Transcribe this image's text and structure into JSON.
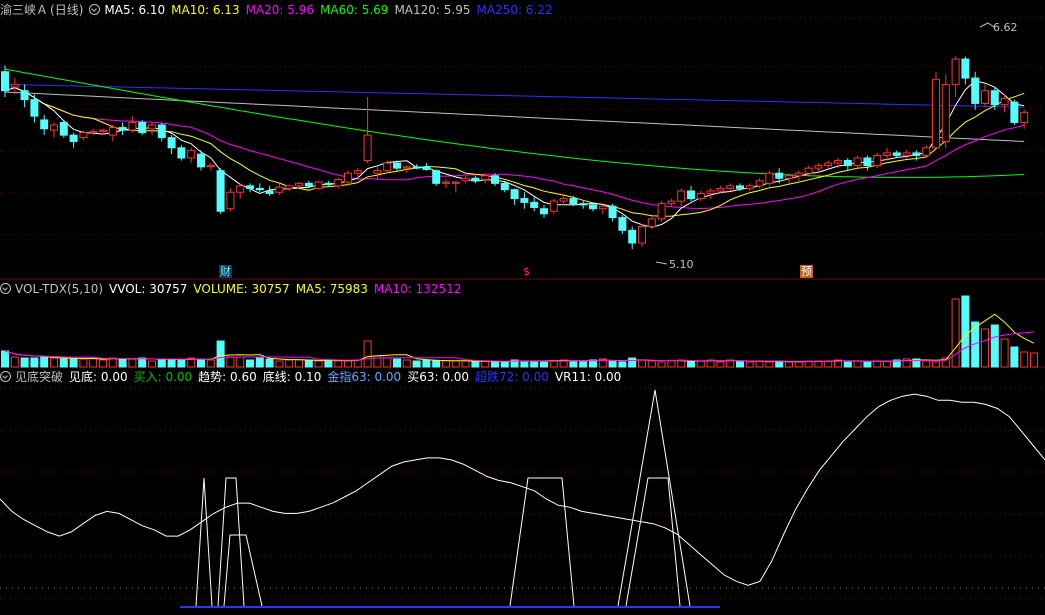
{
  "colors": {
    "background": "#000000",
    "up": "#ff3232",
    "down": "#54fcfc",
    "grid": "#800000",
    "ma5": "#ffffff",
    "ma10": "#ffff00",
    "ma20": "#ff00ff",
    "ma60": "#00ff00",
    "ma120": "#c0c0c0",
    "ma250": "#3030ff",
    "buy": "#00c000",
    "gold": "#5aaaff",
    "vr": "#ffffff"
  },
  "price_panel": {
    "title": "渝三峡Ａ",
    "period": "(日线)",
    "indicators": [
      {
        "label": "MA5: 6.10",
        "color": "#ffffff"
      },
      {
        "label": "MA10: 6.13",
        "color": "#ffff00"
      },
      {
        "label": "MA20: 5.96",
        "color": "#ff00ff"
      },
      {
        "label": "MA60: 5.69",
        "color": "#00ff00"
      },
      {
        "label": "MA120: 5.95",
        "color": "#c0c0c0"
      },
      {
        "label": "MA250: 6.22",
        "color": "#3030ff"
      }
    ],
    "high_label": "6.62",
    "low_label": "5.10",
    "markers": [
      {
        "text": "财",
        "color": "#54fcfc",
        "bg": "#203060"
      },
      {
        "text": "$",
        "color": "#ff3030",
        "bg": ""
      },
      {
        "text": "预",
        "color": "#ffffff",
        "bg": "#c06020"
      }
    ]
  },
  "volume_panel": {
    "indicators": [
      {
        "label": "VOL-TDX(5,10)",
        "color": "#c0c0c0"
      },
      {
        "label": "VVOL: 30757",
        "color": "#ffffff"
      },
      {
        "label": "VOLUME: 30757",
        "color": "#ffff00"
      },
      {
        "label": "MA5: 75983",
        "color": "#ffff00"
      },
      {
        "label": "MA10: 132512",
        "color": "#ff00ff"
      }
    ]
  },
  "indicator_panel": {
    "indicators": [
      {
        "label": "见底突破",
        "color": "#c0c0c0"
      },
      {
        "label": "见底: 0.00",
        "color": "#ffffff"
      },
      {
        "label": "买入: 0.00",
        "color": "#00c000"
      },
      {
        "label": "趋势: 0.60",
        "color": "#ffffff"
      },
      {
        "label": "底线: 0.10",
        "color": "#ffffff"
      },
      {
        "label": "金指63: 0.00",
        "color": "#5aaaff"
      },
      {
        "label": "买63: 0.00",
        "color": "#ffffff"
      },
      {
        "label": "超跌72: 0.00",
        "color": "#3030ff"
      },
      {
        "label": "VR11: 0.00",
        "color": "#ffffff"
      }
    ]
  },
  "chart_data": {
    "type": "candlestick",
    "price_range": [
      5.0,
      6.75
    ],
    "candles": [
      [
        6.5,
        6.55,
        6.3,
        6.35
      ],
      [
        6.38,
        6.45,
        6.32,
        6.4
      ],
      [
        6.35,
        6.4,
        6.22,
        6.28
      ],
      [
        6.28,
        6.32,
        6.1,
        6.15
      ],
      [
        6.12,
        6.16,
        6.0,
        6.05
      ],
      [
        6.04,
        6.1,
        5.98,
        6.08
      ],
      [
        6.1,
        6.12,
        5.98,
        6.0
      ],
      [
        6.0,
        6.02,
        5.9,
        5.95
      ],
      [
        5.98,
        6.04,
        5.96,
        6.02
      ],
      [
        6.02,
        6.05,
        6.0,
        6.03
      ],
      [
        6.03,
        6.05,
        6.0,
        6.04
      ],
      [
        6.0,
        6.08,
        5.95,
        6.06
      ],
      [
        6.06,
        6.1,
        6.0,
        6.04
      ],
      [
        6.04,
        6.15,
        6.02,
        6.1
      ],
      [
        6.1,
        6.12,
        6.0,
        6.02
      ],
      [
        6.05,
        6.1,
        6.0,
        6.08
      ],
      [
        6.08,
        6.1,
        5.95,
        5.98
      ],
      [
        5.98,
        6.0,
        5.85,
        5.9
      ],
      [
        5.9,
        5.92,
        5.8,
        5.82
      ],
      [
        5.82,
        5.9,
        5.78,
        5.88
      ],
      [
        5.85,
        5.88,
        5.72,
        5.75
      ],
      [
        5.75,
        5.78,
        5.72,
        5.76
      ],
      [
        5.72,
        5.74,
        5.38,
        5.4
      ],
      [
        5.42,
        5.58,
        5.4,
        5.55
      ],
      [
        5.55,
        5.62,
        5.5,
        5.6
      ],
      [
        5.6,
        5.62,
        5.55,
        5.58
      ],
      [
        5.58,
        5.62,
        5.55,
        5.57
      ],
      [
        5.56,
        5.6,
        5.52,
        5.54
      ],
      [
        5.55,
        5.62,
        5.53,
        5.59
      ],
      [
        5.58,
        5.61,
        5.56,
        5.6
      ],
      [
        5.6,
        5.63,
        5.58,
        5.62
      ],
      [
        5.62,
        5.64,
        5.58,
        5.6
      ],
      [
        5.58,
        5.64,
        5.57,
        5.63
      ],
      [
        5.62,
        5.64,
        5.6,
        5.61
      ],
      [
        5.6,
        5.66,
        5.58,
        5.65
      ],
      [
        5.63,
        5.72,
        5.6,
        5.7
      ],
      [
        5.7,
        5.74,
        5.66,
        5.72
      ],
      [
        5.8,
        6.3,
        5.78,
        6.0
      ],
      [
        5.7,
        5.75,
        5.65,
        5.72
      ],
      [
        5.72,
        5.8,
        5.7,
        5.78
      ],
      [
        5.78,
        5.8,
        5.72,
        5.74
      ],
      [
        5.74,
        5.76,
        5.7,
        5.75
      ],
      [
        5.75,
        5.77,
        5.73,
        5.74
      ],
      [
        5.75,
        5.78,
        5.72,
        5.73
      ],
      [
        5.72,
        5.73,
        5.6,
        5.62
      ],
      [
        5.62,
        5.65,
        5.58,
        5.63
      ],
      [
        5.62,
        5.64,
        5.55,
        5.63
      ],
      [
        5.64,
        5.68,
        5.62,
        5.66
      ],
      [
        5.66,
        5.68,
        5.62,
        5.64
      ],
      [
        5.65,
        5.7,
        5.62,
        5.68
      ],
      [
        5.68,
        5.7,
        5.6,
        5.62
      ],
      [
        5.62,
        5.63,
        5.55,
        5.57
      ],
      [
        5.57,
        5.58,
        5.45,
        5.5
      ],
      [
        5.5,
        5.55,
        5.42,
        5.47
      ],
      [
        5.47,
        5.52,
        5.4,
        5.43
      ],
      [
        5.42,
        5.45,
        5.35,
        5.38
      ],
      [
        5.4,
        5.5,
        5.38,
        5.48
      ],
      [
        5.48,
        5.52,
        5.45,
        5.5
      ],
      [
        5.5,
        5.52,
        5.44,
        5.46
      ],
      [
        5.46,
        5.48,
        5.42,
        5.45
      ],
      [
        5.45,
        5.47,
        5.4,
        5.42
      ],
      [
        5.42,
        5.45,
        5.38,
        5.44
      ],
      [
        5.44,
        5.46,
        5.32,
        5.35
      ],
      [
        5.35,
        5.37,
        5.22,
        5.25
      ],
      [
        5.25,
        5.28,
        5.1,
        5.15
      ],
      [
        5.15,
        5.3,
        5.12,
        5.28
      ],
      [
        5.28,
        5.36,
        5.26,
        5.34
      ],
      [
        5.34,
        5.48,
        5.32,
        5.46
      ],
      [
        5.46,
        5.5,
        5.44,
        5.48
      ],
      [
        5.48,
        5.58,
        5.44,
        5.56
      ],
      [
        5.56,
        5.6,
        5.48,
        5.5
      ],
      [
        5.5,
        5.56,
        5.48,
        5.54
      ],
      [
        5.54,
        5.58,
        5.5,
        5.56
      ],
      [
        5.56,
        5.6,
        5.54,
        5.58
      ],
      [
        5.58,
        5.62,
        5.56,
        5.6
      ],
      [
        5.6,
        5.62,
        5.56,
        5.58
      ],
      [
        5.58,
        5.62,
        5.56,
        5.6
      ],
      [
        5.6,
        5.66,
        5.58,
        5.64
      ],
      [
        5.62,
        5.72,
        5.6,
        5.7
      ],
      [
        5.7,
        5.74,
        5.62,
        5.66
      ],
      [
        5.66,
        5.7,
        5.62,
        5.68
      ],
      [
        5.68,
        5.72,
        5.64,
        5.7
      ],
      [
        5.7,
        5.76,
        5.68,
        5.74
      ],
      [
        5.74,
        5.78,
        5.7,
        5.76
      ],
      [
        5.76,
        5.8,
        5.74,
        5.78
      ],
      [
        5.78,
        5.82,
        5.74,
        5.8
      ],
      [
        5.8,
        5.82,
        5.72,
        5.76
      ],
      [
        5.76,
        5.84,
        5.74,
        5.82
      ],
      [
        5.82,
        5.84,
        5.72,
        5.76
      ],
      [
        5.76,
        5.86,
        5.74,
        5.84
      ],
      [
        5.84,
        5.9,
        5.8,
        5.86
      ],
      [
        5.86,
        5.88,
        5.82,
        5.84
      ],
      [
        5.84,
        5.88,
        5.82,
        5.86
      ],
      [
        5.86,
        5.88,
        5.8,
        5.84
      ],
      [
        5.84,
        5.92,
        5.82,
        5.9
      ],
      [
        5.9,
        6.5,
        5.9,
        6.44
      ],
      [
        5.95,
        6.48,
        5.9,
        6.4
      ],
      [
        6.4,
        6.62,
        6.3,
        6.6
      ],
      [
        6.6,
        6.62,
        6.4,
        6.45
      ],
      [
        6.45,
        6.5,
        6.2,
        6.25
      ],
      [
        6.25,
        6.4,
        6.22,
        6.35
      ],
      [
        6.35,
        6.38,
        6.2,
        6.24
      ],
      [
        6.24,
        6.32,
        6.18,
        6.29
      ],
      [
        6.26,
        6.28,
        6.08,
        6.1
      ],
      [
        6.1,
        6.2,
        6.05,
        6.18
      ]
    ],
    "volume": [
      16,
      10,
      9,
      9,
      10,
      9,
      8,
      8,
      8,
      9,
      7,
      9,
      8,
      8,
      9,
      6,
      8,
      8,
      7,
      9,
      8,
      7,
      26,
      10,
      10,
      7,
      9,
      8,
      6,
      7,
      7,
      7,
      6,
      7,
      6,
      6,
      7,
      26,
      11,
      9,
      8,
      7,
      6,
      7,
      6,
      6,
      6,
      6,
      5,
      6,
      5,
      5,
      7,
      6,
      6,
      6,
      6,
      7,
      6,
      6,
      7,
      8,
      6,
      5,
      9,
      7,
      6,
      5,
      6,
      7,
      6,
      6,
      7,
      5,
      7,
      6,
      5,
      6,
      5,
      6,
      5,
      5,
      6,
      6,
      6,
      7,
      5,
      6,
      5,
      6,
      6,
      7,
      8,
      8,
      6,
      5,
      9,
      68,
      71,
      45,
      38,
      42,
      28,
      20,
      15,
      14
    ],
    "indicator_trend": [
      0.52,
      0.46,
      0.42,
      0.39,
      0.36,
      0.34,
      0.36,
      0.4,
      0.44,
      0.46,
      0.45,
      0.42,
      0.39,
      0.37,
      0.34,
      0.34,
      0.37,
      0.41,
      0.45,
      0.48,
      0.5,
      0.5,
      0.48,
      0.46,
      0.45,
      0.45,
      0.46,
      0.48,
      0.5,
      0.53,
      0.56,
      0.6,
      0.64,
      0.68,
      0.7,
      0.71,
      0.72,
      0.72,
      0.71,
      0.69,
      0.66,
      0.63,
      0.61,
      0.6,
      0.58,
      0.56,
      0.52,
      0.49,
      0.48,
      0.46,
      0.45,
      0.44,
      0.43,
      0.42,
      0.41,
      0.4,
      0.38,
      0.35,
      0.3,
      0.25,
      0.2,
      0.15,
      0.12,
      0.1,
      0.12,
      0.22,
      0.35,
      0.47,
      0.57,
      0.66,
      0.73,
      0.8,
      0.86,
      0.92,
      0.97,
      1.0,
      1.02,
      1.03,
      1.02,
      1.0,
      1.0,
      0.99,
      0.99,
      0.98,
      0.96,
      0.92,
      0.85,
      0.78,
      0.71
    ]
  }
}
